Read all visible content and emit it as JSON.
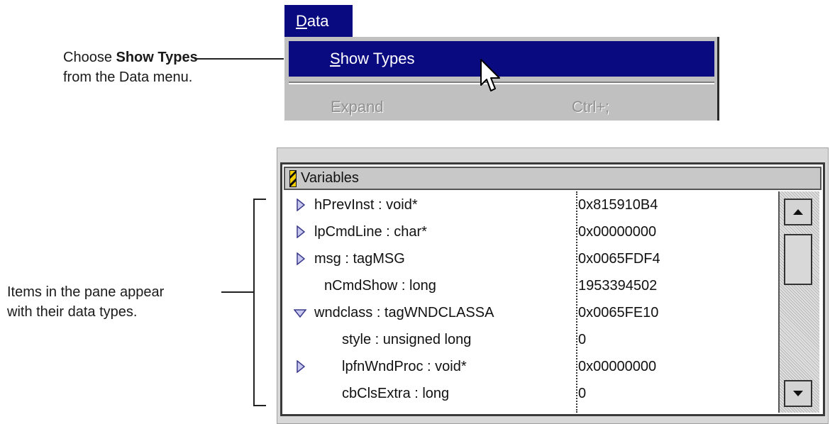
{
  "callouts": {
    "top": {
      "prefix": "Choose ",
      "bold": "Show Types",
      "line2": "from the Data menu."
    },
    "bottom": {
      "line1": "Items in the pane appear",
      "line2": "with their data types."
    }
  },
  "menu": {
    "title_mnemonic": "D",
    "title_rest": "ata",
    "items": [
      {
        "mnemonic": "S",
        "rest": "how Types",
        "state": "highlighted"
      },
      {
        "label": "Expand",
        "shortcut": "Ctrl+;",
        "state": "disabled"
      }
    ]
  },
  "pane": {
    "title": "Variables",
    "rows": [
      {
        "name": "hPrevInst : void*",
        "value": "0x815910B4",
        "expander": "collapsed",
        "indent": 0
      },
      {
        "name": "lpCmdLine : char*",
        "value": "0x00000000",
        "expander": "collapsed",
        "indent": 0
      },
      {
        "name": "msg : tagMSG",
        "value": "0x0065FDF4",
        "expander": "collapsed",
        "indent": 0
      },
      {
        "name": "nCmdShow : long",
        "value": "1953394502",
        "expander": "none",
        "indent": 0
      },
      {
        "name": "wndclass : tagWNDCLASSA",
        "value": "0x0065FE10",
        "expander": "expanded",
        "indent": 0
      },
      {
        "name": "style : unsigned long",
        "value": "0",
        "expander": "none",
        "indent": 1
      },
      {
        "name": "lpfnWndProc : void*",
        "value": "0x00000000",
        "expander": "collapsed",
        "indent": 1
      },
      {
        "name": "cbClsExtra : long",
        "value": "0",
        "expander": "none",
        "indent": 1
      }
    ]
  },
  "icons": {
    "expand": "triangle-right-icon",
    "collapse": "triangle-down-icon",
    "scroll_up": "arrow-up-icon",
    "scroll_down": "arrow-down-icon",
    "pointer": "mouse-pointer-icon",
    "pane": "pane-tag-icon"
  },
  "colors": {
    "menu_highlight": "#0a0a80",
    "menu_text_highlight": "#ffffff",
    "menu_bg": "#c0c0c0",
    "disabled_text": "#909090",
    "triangle_fill": "#c8c8f0",
    "triangle_stroke": "#3a3a8a"
  }
}
